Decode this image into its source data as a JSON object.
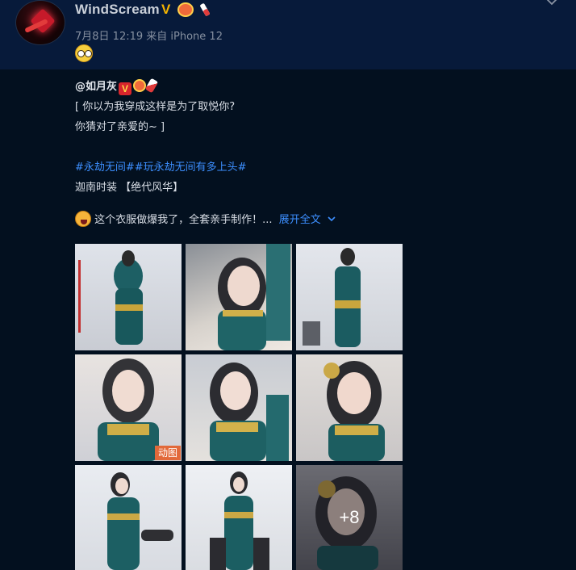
{
  "header": {
    "username": "WindScream",
    "verified_badge": "V",
    "meta": "7月8日 12:19 来自 iPhone 12",
    "reaction_icon": "glasses-face-emoji"
  },
  "post": {
    "mention": "@如月灰",
    "line1": "[ 你以为我穿成这样是为了取悦你?",
    "line2": "你猜对了亲爱的~ ]",
    "topics": "#永劫无间##玩永劫无间有多上头#",
    "line4": "迦南时装 【绝代风华】",
    "line5": "这个衣服做爆我了，全套亲手制作！...",
    "expand_label": "展开全文",
    "mention_badge": "V"
  },
  "gallery": {
    "photo_count": 9,
    "gif_label": "动图",
    "more_label": "+8"
  },
  "colors": {
    "background": "#03101f",
    "header_background": "#071a3a",
    "link": "#3d8fff",
    "gif_badge": "#e2693a"
  }
}
